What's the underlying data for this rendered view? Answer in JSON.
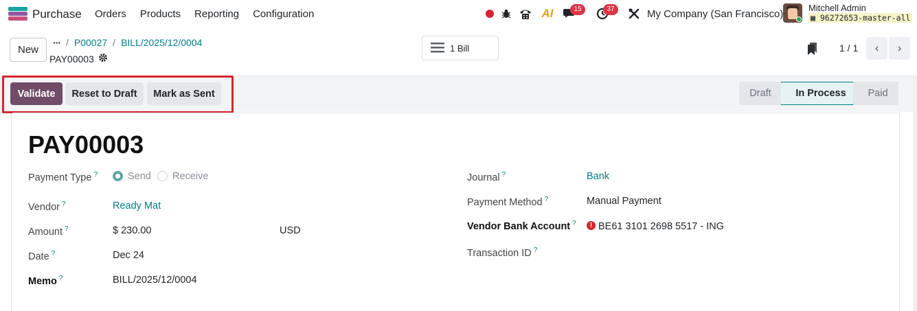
{
  "navbar": {
    "app_name": "Purchase",
    "menu": [
      "Orders",
      "Products",
      "Reporting",
      "Configuration"
    ],
    "chat_badge": "15",
    "activity_badge": "37",
    "company": "My Company (San Francisco)",
    "user_name": "Mitchell Admin",
    "db_name": "96272653-master-all",
    "ai_label": "AI"
  },
  "control": {
    "new_label": "New",
    "breadcrumb": [
      "P00027",
      "BILL/2025/12/0004"
    ],
    "record_name": "PAY00003",
    "smart_button": "1 Bill",
    "pager": "1 / 1"
  },
  "actions": {
    "validate": "Validate",
    "reset": "Reset to Draft",
    "mark_sent": "Mark as Sent"
  },
  "stages": [
    "Draft",
    "In Process",
    "Paid"
  ],
  "form": {
    "title": "PAY00003",
    "labels": {
      "payment_type": "Payment Type",
      "vendor": "Vendor",
      "amount": "Amount",
      "date": "Date",
      "memo": "Memo",
      "journal": "Journal",
      "payment_method": "Payment Method",
      "vendor_bank": "Vendor Bank Account",
      "transaction_id": "Transaction ID"
    },
    "payment_type_options": [
      "Send",
      "Receive"
    ],
    "vendor": "Ready Mat",
    "amount": "$ 230.00",
    "currency": "USD",
    "date": "Dec 24",
    "memo": "BILL/2025/12/0004",
    "journal": "Bank",
    "payment_method": "Manual Payment",
    "vendor_bank": "BE61 3101 2698 5517 - ING"
  },
  "colors": {
    "primary": "#714b67",
    "link": "#017e84",
    "highlight": "#d7262e"
  }
}
